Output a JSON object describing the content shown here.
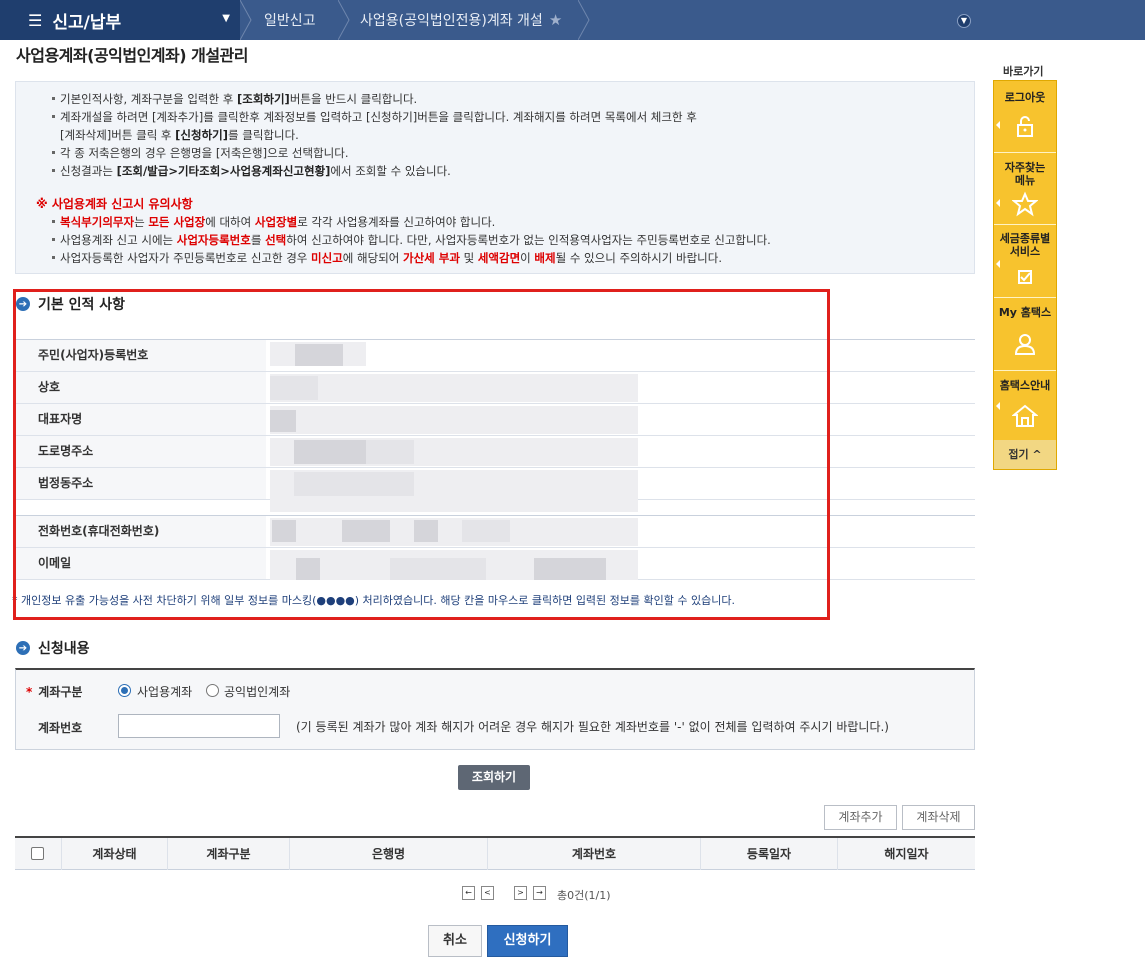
{
  "topbar": {
    "menu_title": "신고/납부",
    "breadcrumb_1": "일반신고",
    "breadcrumb_2": "사업용(공익법인전용)계좌 개설"
  },
  "page_title": "사업용계좌(공익법인계좌) 개설관리",
  "notice": {
    "line1_pre": "기본인적사항, 계좌구분을 입력한 후 ",
    "line1_bold": "[조회하기]",
    "line1_post": "버튼을 반드시 클릭합니다.",
    "line2": "계좌개설을 하려면 [계좌추가]를 클릭한후 계좌정보를 입력하고 [신청하기]버튼을 클릭합니다. 계좌해지를 하려면 목록에서 체크한 후",
    "line3_pre": "[계좌삭제]버튼 클릭 후 ",
    "line3_bold": "[신청하기]",
    "line3_post": "를 클릭합니다.",
    "line4": "각 종 저축은행의 경우 은행명을 [저축은행]으로 선택합니다.",
    "line5_pre": "신청결과는 ",
    "line5_bold": "[조회/발급>기타조회>사업용계좌신고현황]",
    "line5_post": "에서 조회할 수 있습니다.",
    "warn_title": "※ 사업용계좌 신고시 유의사항",
    "w1_a": "복식부기의무자",
    "w1_b": "는 ",
    "w1_c": "모든 사업장",
    "w1_d": "에 대하여 ",
    "w1_e": "사업장별",
    "w1_f": "로 각각 사업용계좌를 신고하여야 합니다.",
    "w2_a": "사업용계좌 신고 시에는 ",
    "w2_b": "사업자등록번호",
    "w2_c": "를 ",
    "w2_d": "선택",
    "w2_e": "하여 신고하여야 합니다. 다만, 사업자등록번호가 없는 인적용역사업자는 주민등록번호로 신고합니다.",
    "w3_a": "사업자등록한 사업자가 주민등록번호로 신고한 경우 ",
    "w3_b": "미신고",
    "w3_c": "에 해당되어 ",
    "w3_d": "가산세 부과",
    "w3_e": " 및 ",
    "w3_f": "세액감면",
    "w3_g": "이 ",
    "w3_h": "배제",
    "w3_i": "될 수 있으니 주의하시기 바랍니다."
  },
  "basic_info": {
    "section_title": "기본 인적 사항",
    "fields": [
      "주민(사업자)등록번호",
      "상호",
      "대표자명",
      "도로명주소",
      "법정동주소",
      "전화번호(휴대전화번호)",
      "이메일"
    ],
    "mask_note": "* 개인정보 유출 가능성을 사전 차단하기 위해 일부 정보를 마스킹(●●●●) 처리하였습니다. 해당 칸을 마우스로 클릭하면 입력된 정보를 확인할 수 있습니다."
  },
  "apply": {
    "section_title": "신청내용",
    "account_type_label": "계좌구분",
    "required_mark": "*",
    "radio_business": "사업용계좌",
    "radio_public": "공익법인계좌",
    "account_number_label": "계좌번호",
    "account_number_value": "",
    "account_help": "(기 등록된 계좌가 많아 계좌 해지가 어려운 경우 해지가 필요한 계좌번호를 '-' 없이 전체를 입력하여 주시기 바랍니다.)",
    "search_button": "조회하기"
  },
  "table": {
    "add_button": "계좌추가",
    "delete_button": "계좌삭제",
    "columns": [
      "계좌상태",
      "계좌구분",
      "은행명",
      "계좌번호",
      "등록일자",
      "해지일자"
    ],
    "rows": []
  },
  "pager": {
    "first": "←",
    "prev": "<",
    "next": ">",
    "last": "→",
    "count_text": "총0건(1/1)"
  },
  "footer": {
    "cancel_button": "취소",
    "submit_button": "신청하기"
  },
  "quick_menu": {
    "title": "바로가기",
    "items": [
      "로그아웃",
      "자주찾는 메뉴",
      "세금종류별 서비스",
      "My 홈택스",
      "홈택스안내"
    ],
    "close": "접기 ^"
  },
  "colors": {
    "nav": "#3a5a8c",
    "nav_dark": "#1f3e6e",
    "highlight_frame": "#e0201c",
    "accent_blue": "#2f6fc0",
    "quick_menu": "#f7c32e"
  }
}
